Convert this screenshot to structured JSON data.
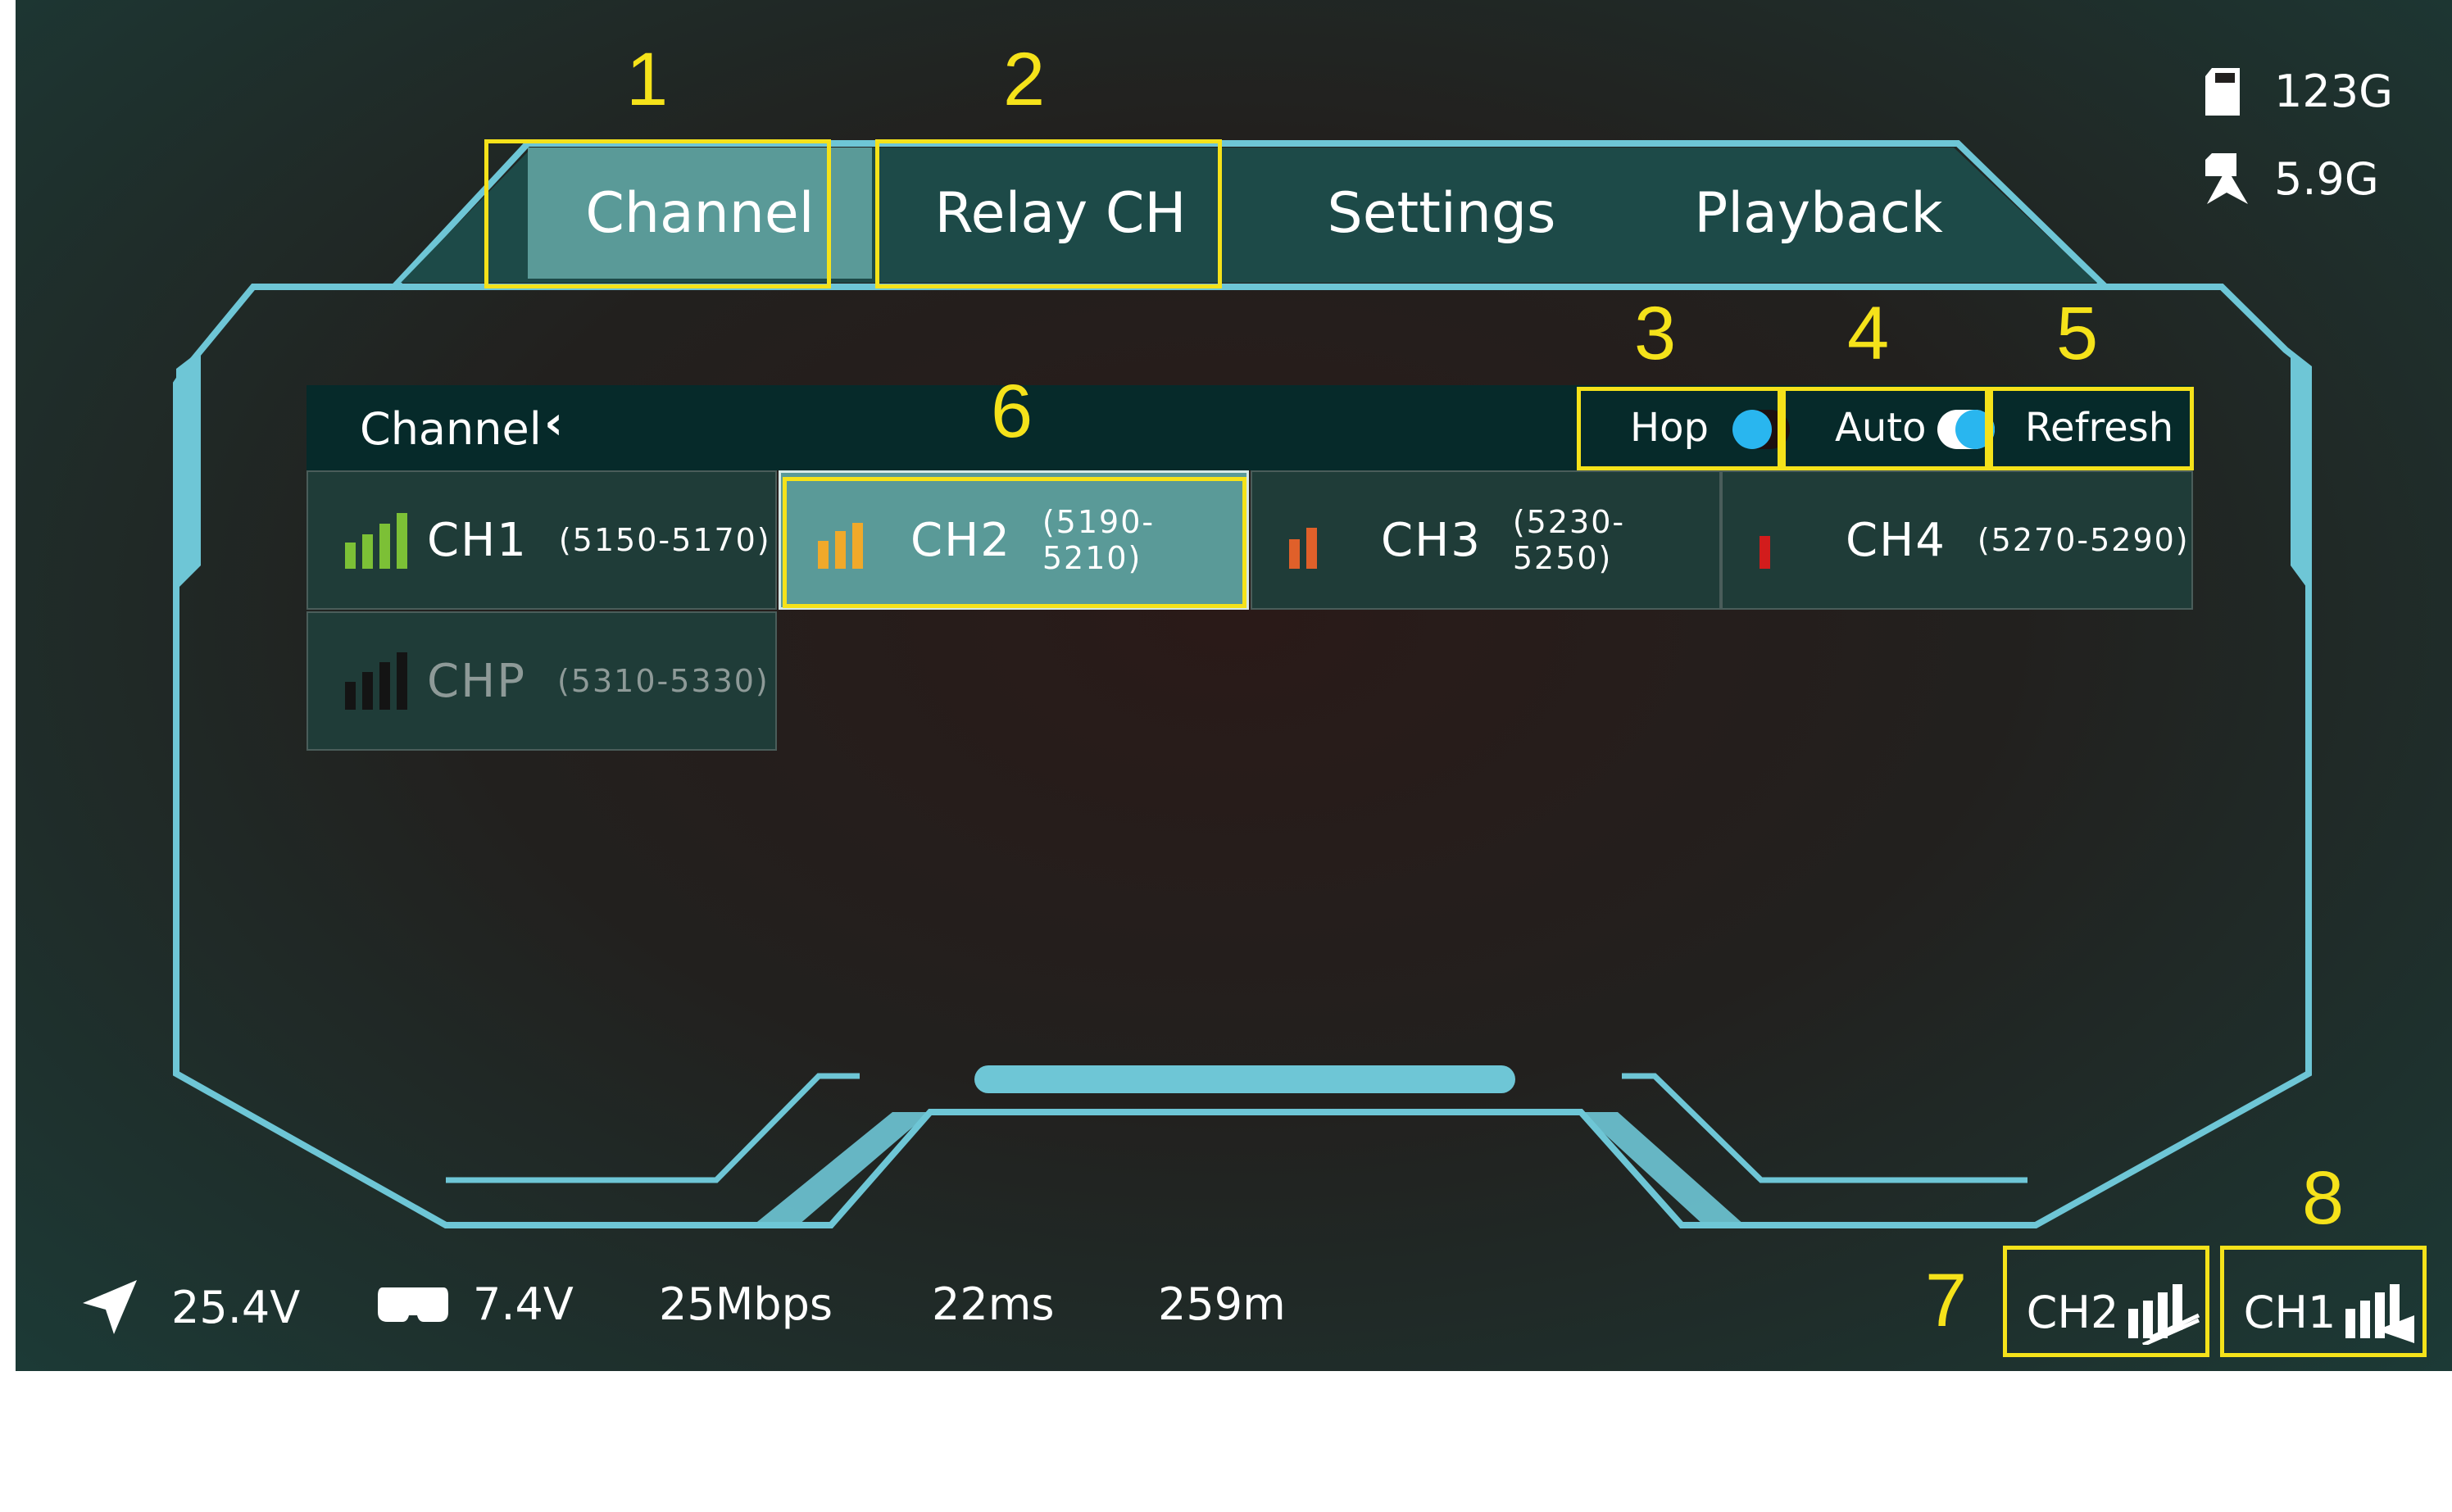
{
  "tabs": [
    {
      "label": "Channel",
      "active": true
    },
    {
      "label": "Relay CH",
      "active": false
    },
    {
      "label": "Settings",
      "active": false
    },
    {
      "label": "Playback",
      "active": false
    }
  ],
  "storage": {
    "sd_card": "123G",
    "recording": "5.9G"
  },
  "panel": {
    "title": "Channel",
    "back_icon": "chevron-left-icon",
    "hop_label": "Hop",
    "hop_on": false,
    "auto_label": "Auto",
    "auto_on": true,
    "refresh_label": "Refresh"
  },
  "channels": [
    {
      "name": "CH1",
      "range": "(5150-5170)",
      "signal_color": "#7cc036",
      "selected": false
    },
    {
      "name": "CH2",
      "range": "(5190-5210)",
      "signal_color": "#f0a92a",
      "selected": true
    },
    {
      "name": "CH3",
      "range": "(5230-5250)",
      "signal_color": "#e0602a",
      "selected": false
    },
    {
      "name": "CH4",
      "range": "(5270-5290)",
      "signal_color": "#d21c1c",
      "selected": false
    },
    {
      "name": "CHP",
      "range": "(5310-5330)",
      "signal_color": "#141414",
      "selected": false
    }
  ],
  "status": {
    "drone_voltage": "25.4V",
    "goggle_voltage": "7.4V",
    "bitrate": "25Mbps",
    "latency": "22ms",
    "distance": "259m",
    "relay_channel": "CH2",
    "direct_channel": "CH1"
  },
  "annotations": [
    "1",
    "2",
    "3",
    "4",
    "5",
    "6",
    "7",
    "8"
  ],
  "colors": {
    "accent": "#6ec6d6",
    "highlight": "#f5e21a",
    "toggle": "#29b6ef"
  }
}
